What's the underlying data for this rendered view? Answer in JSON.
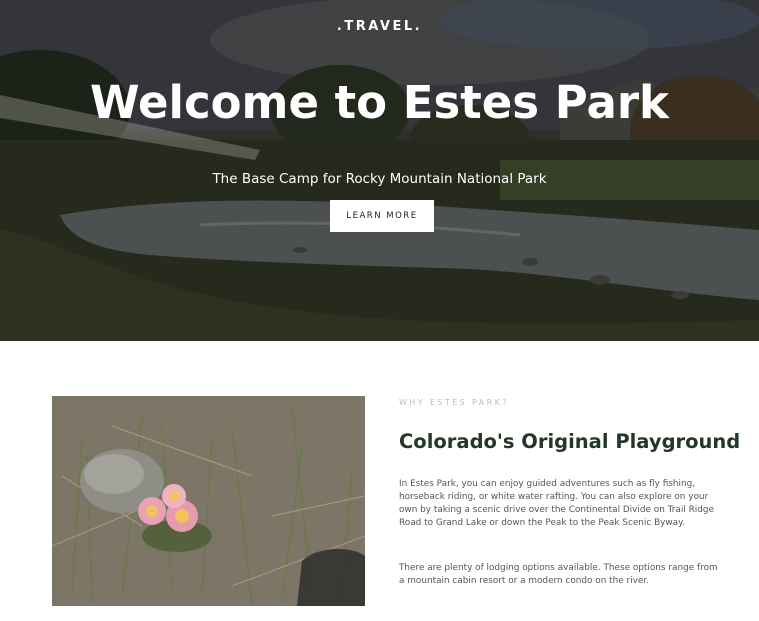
{
  "hero": {
    "brand": ".TRAVEL.",
    "title": "Welcome to Estes Park",
    "subtitle": "The Base Camp for Rocky Mountain National Park",
    "button_label": "LEARN MORE"
  },
  "about": {
    "eyebrow": "WHY ESTES PARK?",
    "heading": "Colorado's Original Playground",
    "paragraphs": [
      "In Estes Park, you can enjoy guided adventures such as fly fishing, horseback riding, or white water rafting. You can also explore on your own by taking a scenic drive over the Continental Divide on Trail Ridge Road to Grand Lake or down the Peak to the Peak Scenic Byway.",
      "There are plenty of lodging options available. These options range from a mountain cabin resort or a modern condo on the river."
    ]
  },
  "colors": {
    "heading_green": "#233826",
    "body_text": "#4f5a4f",
    "eyebrow_gray": "#b9bdb9"
  }
}
